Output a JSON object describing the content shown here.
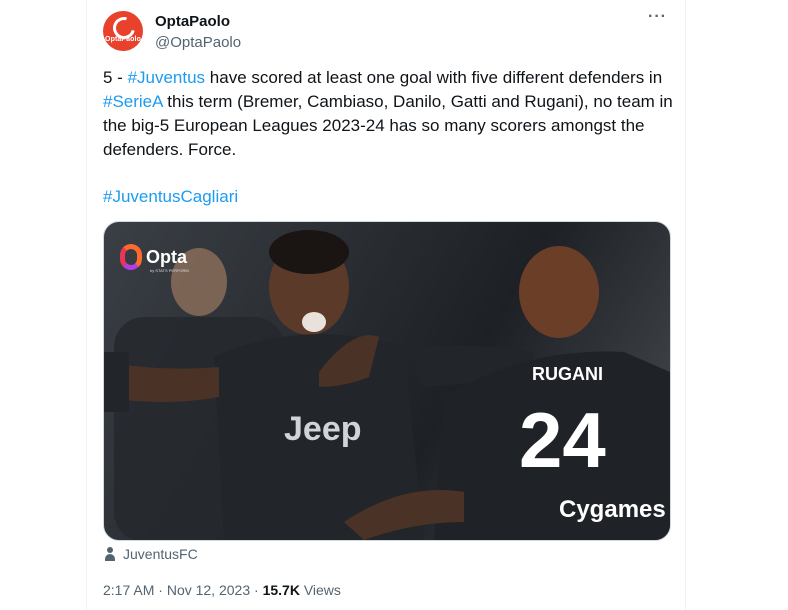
{
  "tweet": {
    "author_name": "OptaPaolo",
    "author_handle": "@OptaPaolo",
    "avatar_text": "OptaPaolo",
    "more_icon": "ellipsis-icon",
    "text_part1": "5 - ",
    "tag_juventus": "#Juventus",
    "text_part2": " have scored at least one goal with five different defenders in ",
    "tag_seriea": "#SerieA",
    "text_part3": " this term (Bremer, Cambiaso, Danilo, Gatti and Rugani), no team in the big-5 European Leagues 2023-24 has so many scorers amongst the defenders. Force.",
    "hashtag_line": "#JuventusCagliari",
    "media": {
      "logo_text": "Opta",
      "logo_sub": "by STATS PERFORM",
      "shirt_name": "RUGANI",
      "shirt_number": "24",
      "sponsor": "Jeep",
      "sponsor2": "Cygames"
    },
    "tagged_user": "JuventusFC",
    "time": "2:17 AM",
    "separator": "·",
    "date": "Nov 12, 2023",
    "views_count": "15.7K",
    "views_label": "Views"
  }
}
